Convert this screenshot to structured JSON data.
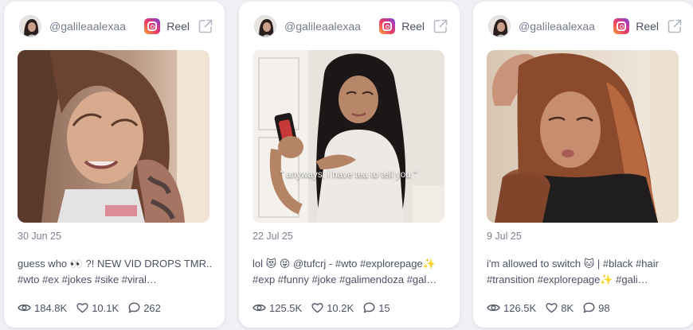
{
  "posts": [
    {
      "handle": "@galileaalexaa",
      "platform_icon": "instagram-icon",
      "type": "Reel",
      "date": "30 Jun 25",
      "caption_line1": "guess who 👀 ?! NEW VID DROPS TMR.. -",
      "caption_line2": "#wto #ex #jokes #sike #viral…",
      "overlay_text": "",
      "views": "184.8K",
      "likes": "10.1K",
      "comments": "262"
    },
    {
      "handle": "@galileaalexaa",
      "platform_icon": "instagram-icon",
      "type": "Reel",
      "date": "22 Jul 25",
      "caption_line1": "lol 😻 😝 @tufcrj - #wto #explorepage✨",
      "caption_line2": "#exp #funny #joke #galimendoza #gal…",
      "overlay_text": "\" anyways, i have tea to tell you \"",
      "views": "125.5K",
      "likes": "10.2K",
      "comments": "15"
    },
    {
      "handle": "@galileaalexaa",
      "platform_icon": "instagram-icon",
      "type": "Reel",
      "date": "9 Jul 25",
      "caption_line1": "i'm allowed to switch 🐱 | #black #hair",
      "caption_line2": "#transition #explorepage✨ #gali…",
      "overlay_text": "",
      "views": "126.5K",
      "likes": "8K",
      "comments": "98"
    }
  ],
  "colors": {
    "background": "#eef0f4",
    "card": "#ffffff",
    "text_muted": "#7c8290",
    "text_body": "#4c5262"
  }
}
